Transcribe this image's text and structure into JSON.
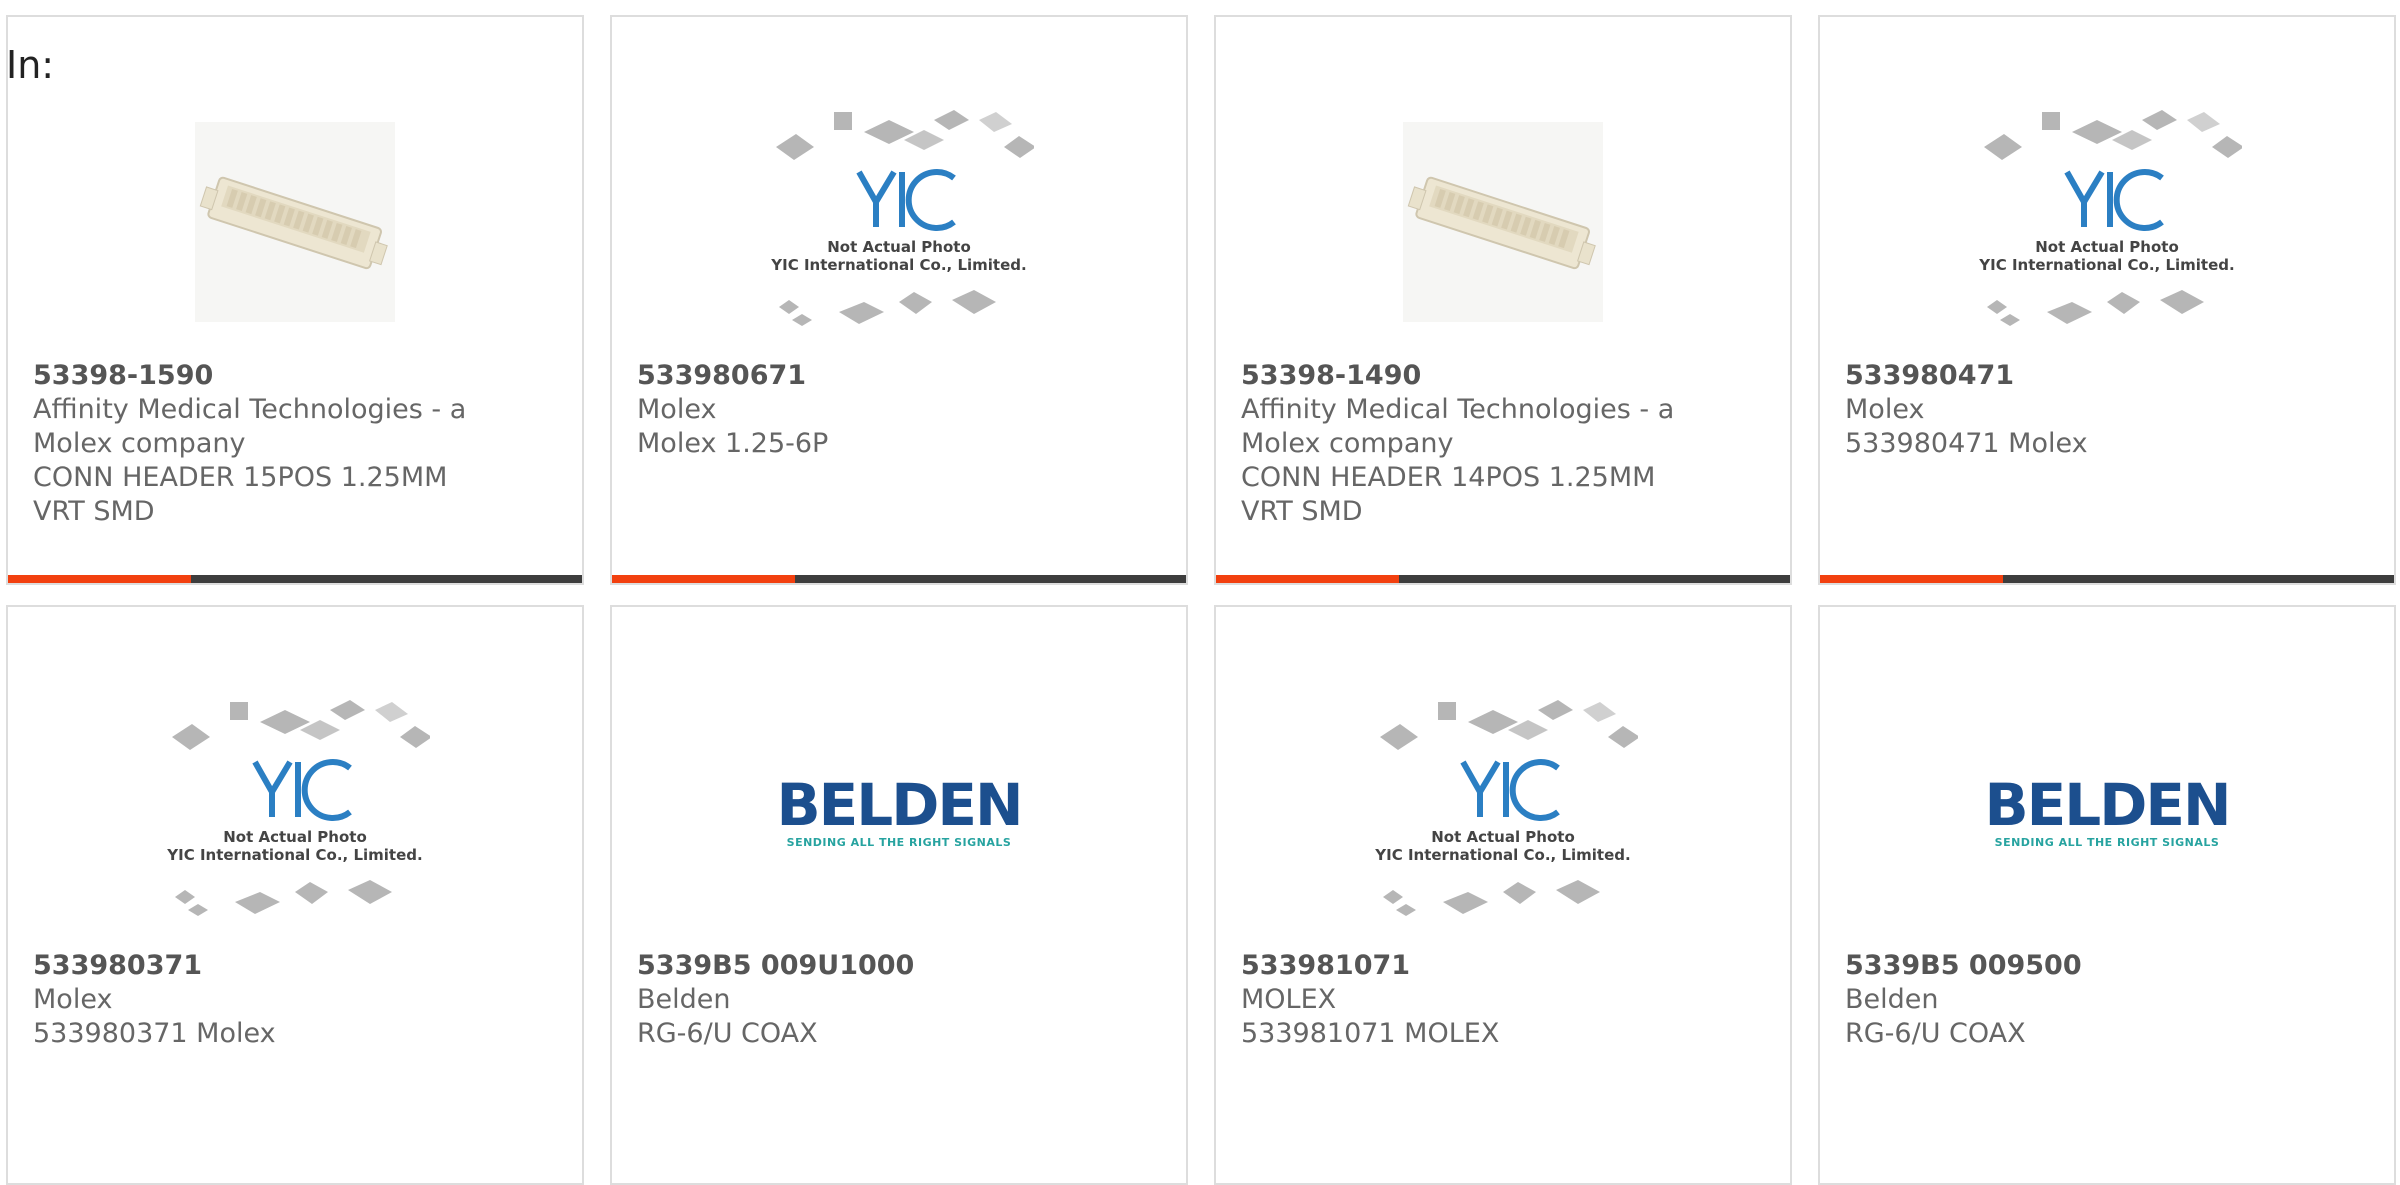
{
  "filter_label": "In:",
  "row1": [
    {
      "part": "53398-1590",
      "mfr": "Affinity Medical Technologies - a Molex company",
      "desc": "CONN HEADER 15POS 1.25MM VRT SMD",
      "image": "connector-photo"
    },
    {
      "part": "533980671",
      "mfr": "Molex",
      "desc": "Molex 1.25-6P",
      "image": "yic-placeholder"
    },
    {
      "part": "53398-1490",
      "mfr": "Affinity Medical Technologies - a Molex company",
      "desc": "CONN HEADER 14POS 1.25MM VRT SMD",
      "image": "connector-photo"
    },
    {
      "part": "533980471",
      "mfr": "Molex",
      "desc": "533980471 Molex",
      "image": "yic-placeholder"
    }
  ],
  "row2": [
    {
      "part": "533980371",
      "mfr": "Molex",
      "desc": "533980371 Molex",
      "image": "yic-placeholder"
    },
    {
      "part": "5339B5 009U1000",
      "mfr": "Belden",
      "desc": "RG-6/U COAX",
      "image": "belden-logo"
    },
    {
      "part": "533981071",
      "mfr": "MOLEX",
      "desc": "533981071 MOLEX",
      "image": "yic-placeholder"
    },
    {
      "part": "5339B5 009500",
      "mfr": "Belden",
      "desc": "RG-6/U COAX",
      "image": "belden-logo"
    }
  ],
  "yic": {
    "line1": "Not Actual Photo",
    "line2": "YIC International Co., Limited."
  },
  "belden": {
    "word": "BELDEN",
    "tag": "SENDING ALL THE RIGHT SIGNALS"
  },
  "colors": {
    "accent": "#f2400f",
    "bar": "#3d3d3d",
    "text": "#666666",
    "belden_blue": "#1c4f8e",
    "belden_teal": "#27a3a0",
    "yic_blue": "#2b7fc3"
  }
}
